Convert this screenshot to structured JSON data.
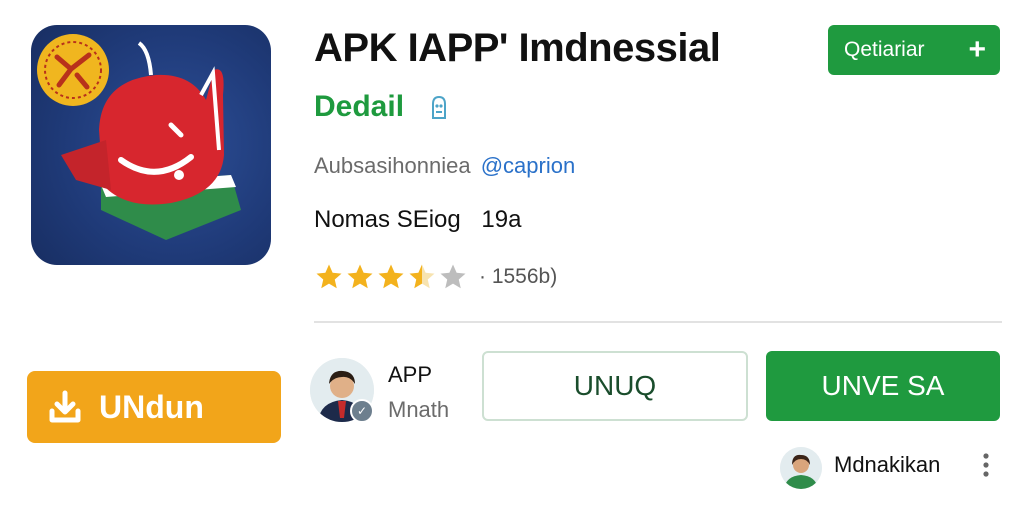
{
  "app": {
    "title": "APK IAPP' Imdnessial",
    "subtitle": "Dedail",
    "publisher": "Aubsasihonniea",
    "publisher_link": "@caprion",
    "meta_label": "Nomas SEiog",
    "meta_value": "19a",
    "rating_value": 3.5,
    "rating_count": "· 1556b)"
  },
  "top_action": {
    "label": "Qetiariar",
    "icon": "plus-icon"
  },
  "download_button": {
    "label": "UNdun",
    "icon": "download-icon"
  },
  "developer": {
    "name": "APP",
    "subtitle": "Mnath"
  },
  "buttons": {
    "outline_label": "UNUQ",
    "primary_label": "UNVE SA"
  },
  "user": {
    "name": "Mdnakikan"
  },
  "colors": {
    "brand_green": "#1f9a3f",
    "download_orange": "#f2a51a",
    "link_blue": "#2a71c9",
    "star_gold": "#f3b21d",
    "icon_background": "#1f3a78"
  }
}
